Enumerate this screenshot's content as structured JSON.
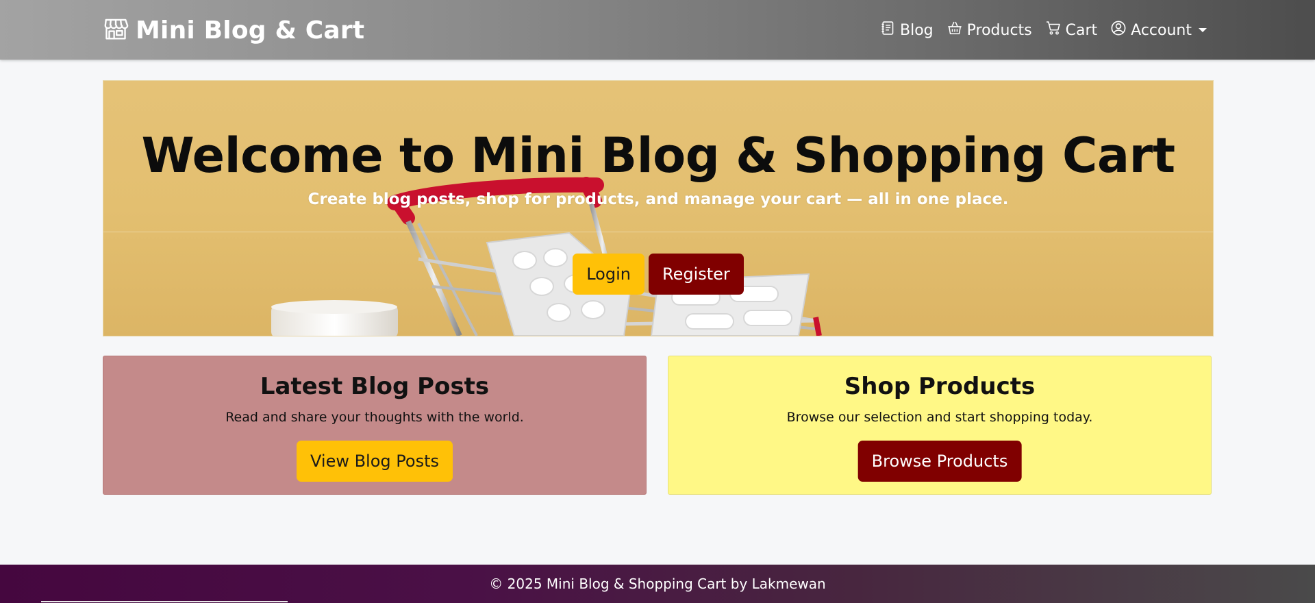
{
  "navbar": {
    "brand": "Mini Blog & Cart",
    "links": {
      "blog": "Blog",
      "products": "Products",
      "cart": "Cart",
      "account": "Account"
    }
  },
  "hero": {
    "title": "Welcome to Mini Blog & Shopping Cart",
    "subtitle": "Create blog posts, shop for products, and manage your cart — all in one place.",
    "login_label": "Login",
    "register_label": "Register"
  },
  "cards": {
    "blog": {
      "title": "Latest Blog Posts",
      "text": "Read and share your thoughts with the world.",
      "button": "View Blog Posts"
    },
    "shop": {
      "title": "Shop Products",
      "text": "Browse our selection and start shopping today.",
      "button": "Browse Products"
    }
  },
  "footer": {
    "text": "© 2025 Mini Blog & Shopping Cart by Lakmewan"
  },
  "colors": {
    "accent_yellow": "#ffc107",
    "accent_maroon": "#800000",
    "blog_card": "#c48a8a",
    "shop_card": "#fff886",
    "hero_bg": "#e4c174"
  },
  "icons": {
    "brand": "shop-icon",
    "blog": "journal-icon",
    "products": "basket-icon",
    "cart": "cart-icon",
    "account": "person-circle-icon"
  }
}
